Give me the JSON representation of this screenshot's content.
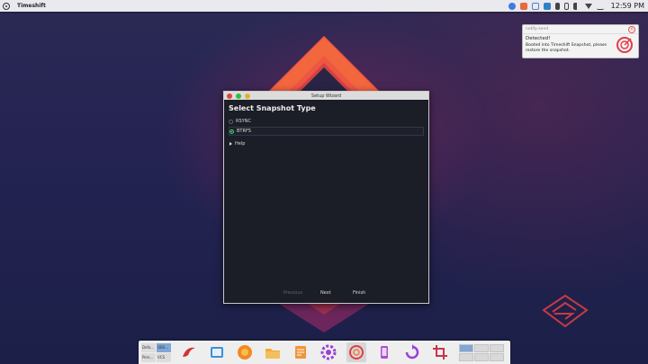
{
  "panel": {
    "app_name": "Timeshift",
    "clock": "12:59 PM",
    "tray_icons": [
      "info-icon",
      "puzzle-icon",
      "image-icon",
      "vscode-icon",
      "bluetooth-icon",
      "battery-icon",
      "volume-icon",
      "wifi-icon",
      "dropdown-icon"
    ]
  },
  "notification": {
    "source": "notify-send",
    "title": "Detected!",
    "body": "Booted into Timeshift Snapshot, please restore the snapshot.",
    "icon": "timeshift-icon"
  },
  "wizard": {
    "window_title": "Setup Wizard",
    "heading": "Select Snapshot Type",
    "options": [
      {
        "label": "RSYNC",
        "selected": false
      },
      {
        "label": "BTRFS",
        "selected": true
      }
    ],
    "help_label": "Help",
    "buttons": {
      "previous": "Previous",
      "next": "Next",
      "finish": "Finish"
    }
  },
  "dock": {
    "workspace_labels": [
      "Defa...",
      "OBS...",
      "Pers...",
      "VCS"
    ],
    "apps": [
      "browser-icon",
      "image-viewer-icon",
      "firefox-icon",
      "files-icon",
      "text-editor-icon",
      "settings-icon",
      "timeshift-icon",
      "phone-icon",
      "refresh-icon",
      "crop-icon"
    ],
    "active_app": "timeshift-icon"
  },
  "colors": {
    "accent_green": "#3fd07a",
    "dock_active": "#7fa7d8",
    "window_bg": "#1b1d27"
  }
}
